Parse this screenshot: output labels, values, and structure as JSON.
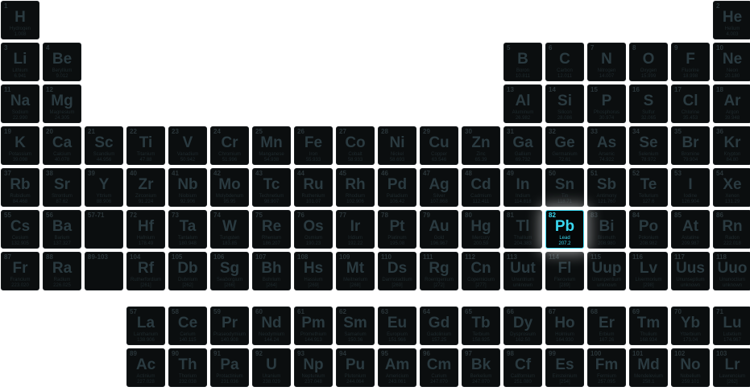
{
  "elements": [
    {
      "n": "1",
      "s": "H",
      "name": "Hydrogen",
      "m": "1.008",
      "row": 1,
      "col": 1
    },
    {
      "n": "2",
      "s": "He",
      "name": "Helium",
      "m": "4.003",
      "row": 1,
      "col": 18
    },
    {
      "n": "3",
      "s": "Li",
      "name": "Lithium",
      "m": "6.941",
      "row": 2,
      "col": 1
    },
    {
      "n": "4",
      "s": "Be",
      "name": "Beryllium",
      "m": "9.012",
      "row": 2,
      "col": 2
    },
    {
      "n": "5",
      "s": "B",
      "name": "Boron",
      "m": "10.811",
      "row": 2,
      "col": 13
    },
    {
      "n": "6",
      "s": "C",
      "name": "Carbon",
      "m": "12.011",
      "row": 2,
      "col": 14
    },
    {
      "n": "7",
      "s": "N",
      "name": "Nitrogen",
      "m": "14.007",
      "row": 2,
      "col": 15
    },
    {
      "n": "8",
      "s": "O",
      "name": "Oxygen",
      "m": "15.999",
      "row": 2,
      "col": 16
    },
    {
      "n": "9",
      "s": "F",
      "name": "Fluorine",
      "m": "18.998",
      "row": 2,
      "col": 17
    },
    {
      "n": "10",
      "s": "Ne",
      "name": "Neon",
      "m": "20.180",
      "row": 2,
      "col": 18
    },
    {
      "n": "11",
      "s": "Na",
      "name": "Sodium",
      "m": "22.990",
      "row": 3,
      "col": 1
    },
    {
      "n": "12",
      "s": "Mg",
      "name": "Magnesium",
      "m": "24.305",
      "row": 3,
      "col": 2
    },
    {
      "n": "13",
      "s": "Al",
      "name": "Aluminum",
      "m": "26.982",
      "row": 3,
      "col": 13
    },
    {
      "n": "14",
      "s": "Si",
      "name": "Silicon",
      "m": "28.086",
      "row": 3,
      "col": 14
    },
    {
      "n": "15",
      "s": "P",
      "name": "Phosphorus",
      "m": "30.974",
      "row": 3,
      "col": 15
    },
    {
      "n": "16",
      "s": "S",
      "name": "Sulfur",
      "m": "32.065",
      "row": 3,
      "col": 16
    },
    {
      "n": "17",
      "s": "Cl",
      "name": "Chlorine",
      "m": "35.453",
      "row": 3,
      "col": 17
    },
    {
      "n": "18",
      "s": "Ar",
      "name": "Argon",
      "m": "39.948",
      "row": 3,
      "col": 18
    },
    {
      "n": "19",
      "s": "K",
      "name": "Potassium",
      "m": "39.098",
      "row": 4,
      "col": 1
    },
    {
      "n": "20",
      "s": "Ca",
      "name": "Calcium",
      "m": "40.078",
      "row": 4,
      "col": 2
    },
    {
      "n": "21",
      "s": "Sc",
      "name": "Scandium",
      "m": "44.956",
      "row": 4,
      "col": 3
    },
    {
      "n": "22",
      "s": "Ti",
      "name": "Titanium",
      "m": "47.88",
      "row": 4,
      "col": 4
    },
    {
      "n": "23",
      "s": "V",
      "name": "Vanadium",
      "m": "50.942",
      "row": 4,
      "col": 5
    },
    {
      "n": "24",
      "s": "Cr",
      "name": "Chromium",
      "m": "51.996",
      "row": 4,
      "col": 6
    },
    {
      "n": "25",
      "s": "Mn",
      "name": "Manganese",
      "m": "54.938",
      "row": 4,
      "col": 7
    },
    {
      "n": "26",
      "s": "Fe",
      "name": "Iron",
      "m": "55.933",
      "row": 4,
      "col": 8
    },
    {
      "n": "27",
      "s": "Co",
      "name": "Cobalt",
      "m": "58.933",
      "row": 4,
      "col": 9
    },
    {
      "n": "28",
      "s": "Ni",
      "name": "Nickel",
      "m": "58.693",
      "row": 4,
      "col": 10
    },
    {
      "n": "29",
      "s": "Cu",
      "name": "Copper",
      "m": "63.546",
      "row": 4,
      "col": 11
    },
    {
      "n": "30",
      "s": "Zn",
      "name": "Zinc",
      "m": "65.39",
      "row": 4,
      "col": 12
    },
    {
      "n": "31",
      "s": "Ga",
      "name": "Gallium",
      "m": "69.732",
      "row": 4,
      "col": 13
    },
    {
      "n": "32",
      "s": "Ge",
      "name": "Germanium",
      "m": "72.61",
      "row": 4,
      "col": 14
    },
    {
      "n": "33",
      "s": "As",
      "name": "Arsenic",
      "m": "74.922",
      "row": 4,
      "col": 15
    },
    {
      "n": "34",
      "s": "Se",
      "name": "Selenium",
      "m": "78.972",
      "row": 4,
      "col": 16
    },
    {
      "n": "35",
      "s": "Br",
      "name": "Bromine",
      "m": "79.904",
      "row": 4,
      "col": 17
    },
    {
      "n": "36",
      "s": "Kr",
      "name": "Krypton",
      "m": "84.80",
      "row": 4,
      "col": 18
    },
    {
      "n": "37",
      "s": "Rb",
      "name": "Rubidium",
      "m": "84.468",
      "row": 5,
      "col": 1
    },
    {
      "n": "38",
      "s": "Sr",
      "name": "Strontium",
      "m": "87.62",
      "row": 5,
      "col": 2
    },
    {
      "n": "39",
      "s": "Y",
      "name": "Yttrium",
      "m": "88.906",
      "row": 5,
      "col": 3
    },
    {
      "n": "40",
      "s": "Zr",
      "name": "Zirconium",
      "m": "91.224",
      "row": 5,
      "col": 4
    },
    {
      "n": "41",
      "s": "Nb",
      "name": "Niobium",
      "m": "92.906",
      "row": 5,
      "col": 5
    },
    {
      "n": "42",
      "s": "Mo",
      "name": "Molybdenum",
      "m": "95.95",
      "row": 5,
      "col": 6
    },
    {
      "n": "43",
      "s": "Tc",
      "name": "Technetium",
      "m": "98.907",
      "row": 5,
      "col": 7
    },
    {
      "n": "44",
      "s": "Ru",
      "name": "Ruthenium",
      "m": "101.07",
      "row": 5,
      "col": 8
    },
    {
      "n": "45",
      "s": "Rh",
      "name": "Rhodium",
      "m": "102.906",
      "row": 5,
      "col": 9
    },
    {
      "n": "46",
      "s": "Pd",
      "name": "Palladium",
      "m": "106.42",
      "row": 5,
      "col": 10
    },
    {
      "n": "47",
      "s": "Ag",
      "name": "Silver",
      "m": "107.868",
      "row": 5,
      "col": 11
    },
    {
      "n": "48",
      "s": "Cd",
      "name": "Cadmium",
      "m": "112.411",
      "row": 5,
      "col": 12
    },
    {
      "n": "49",
      "s": "In",
      "name": "Indium",
      "m": "114.818",
      "row": 5,
      "col": 13
    },
    {
      "n": "50",
      "s": "Sn",
      "name": "Tin",
      "m": "118.71",
      "row": 5,
      "col": 14
    },
    {
      "n": "51",
      "s": "Sb",
      "name": "Antimony",
      "m": "121.760",
      "row": 5,
      "col": 15
    },
    {
      "n": "52",
      "s": "Te",
      "name": "Tellurium",
      "m": "127.6",
      "row": 5,
      "col": 16
    },
    {
      "n": "53",
      "s": "I",
      "name": "Iodine",
      "m": "126.904",
      "row": 5,
      "col": 17
    },
    {
      "n": "54",
      "s": "Xe",
      "name": "Xenon",
      "m": "131.29",
      "row": 5,
      "col": 18
    },
    {
      "n": "55",
      "s": "Cs",
      "name": "Cesium",
      "m": "132.905",
      "row": 6,
      "col": 1
    },
    {
      "n": "56",
      "s": "Ba",
      "name": "Barium",
      "m": "137.327",
      "row": 6,
      "col": 2
    },
    {
      "n": "57-71",
      "s": "",
      "name": "",
      "m": "",
      "row": 6,
      "col": 3,
      "range": true
    },
    {
      "n": "72",
      "s": "Hf",
      "name": "Hafnium",
      "m": "178.49",
      "row": 6,
      "col": 4
    },
    {
      "n": "73",
      "s": "Ta",
      "name": "Tantalum",
      "m": "180.948",
      "row": 6,
      "col": 5
    },
    {
      "n": "74",
      "s": "W",
      "name": "Tungsten",
      "m": "183.85",
      "row": 6,
      "col": 6
    },
    {
      "n": "75",
      "s": "Re",
      "name": "Rhenium",
      "m": "186.207",
      "row": 6,
      "col": 7
    },
    {
      "n": "76",
      "s": "Os",
      "name": "Osmium",
      "m": "190.23",
      "row": 6,
      "col": 8
    },
    {
      "n": "77",
      "s": "Ir",
      "name": "Iridium",
      "m": "192.22",
      "row": 6,
      "col": 9
    },
    {
      "n": "78",
      "s": "Pt",
      "name": "Platinum",
      "m": "195.08",
      "row": 6,
      "col": 10
    },
    {
      "n": "79",
      "s": "Au",
      "name": "Gold",
      "m": "196.967",
      "row": 6,
      "col": 11
    },
    {
      "n": "80",
      "s": "Hg",
      "name": "Mercury",
      "m": "200.59",
      "row": 6,
      "col": 12
    },
    {
      "n": "81",
      "s": "Tl",
      "name": "Thallium",
      "m": "204.383",
      "row": 6,
      "col": 13
    },
    {
      "n": "82",
      "s": "Pb",
      "name": "Lead",
      "m": "207.2",
      "row": 6,
      "col": 14,
      "active": true
    },
    {
      "n": "83",
      "s": "Bi",
      "name": "Bismuth",
      "m": "208.980",
      "row": 6,
      "col": 15
    },
    {
      "n": "84",
      "s": "Po",
      "name": "Polonium",
      "m": "208.982",
      "row": 6,
      "col": 16
    },
    {
      "n": "85",
      "s": "At",
      "name": "Astatine",
      "m": "209.987",
      "row": 6,
      "col": 17
    },
    {
      "n": "86",
      "s": "Rn",
      "name": "Radon",
      "m": "222.018",
      "row": 6,
      "col": 18
    },
    {
      "n": "87",
      "s": "Fr",
      "name": "Francium",
      "m": "223.020",
      "row": 7,
      "col": 1
    },
    {
      "n": "88",
      "s": "Ra",
      "name": "Radium",
      "m": "226.025",
      "row": 7,
      "col": 2
    },
    {
      "n": "89-103",
      "s": "",
      "name": "",
      "m": "",
      "row": 7,
      "col": 3,
      "range": true
    },
    {
      "n": "104",
      "s": "Rf",
      "name": "Rutherfordium",
      "m": "[261]",
      "row": 7,
      "col": 4
    },
    {
      "n": "105",
      "s": "Db",
      "name": "Dubnium",
      "m": "[262]",
      "row": 7,
      "col": 5
    },
    {
      "n": "106",
      "s": "Sg",
      "name": "Seaborgium",
      "m": "[266]",
      "row": 7,
      "col": 6
    },
    {
      "n": "107",
      "s": "Bh",
      "name": "Bohrium",
      "m": "[264]",
      "row": 7,
      "col": 7
    },
    {
      "n": "108",
      "s": "Hs",
      "name": "Hassium",
      "m": "[269]",
      "row": 7,
      "col": 8
    },
    {
      "n": "109",
      "s": "Mt",
      "name": "Meitnerium",
      "m": "[268]",
      "row": 7,
      "col": 9
    },
    {
      "n": "110",
      "s": "Ds",
      "name": "Darmstadtium",
      "m": "[269]",
      "row": 7,
      "col": 10
    },
    {
      "n": "111",
      "s": "Rg",
      "name": "Roentgenium",
      "m": "[272]",
      "row": 7,
      "col": 11
    },
    {
      "n": "112",
      "s": "Cn",
      "name": "Copernicium",
      "m": "[277]",
      "row": 7,
      "col": 12
    },
    {
      "n": "113",
      "s": "Uut",
      "name": "Ununtrium",
      "m": "unknown",
      "row": 7,
      "col": 13
    },
    {
      "n": "114",
      "s": "Fl",
      "name": "Flerovium",
      "m": "[289]",
      "row": 7,
      "col": 14
    },
    {
      "n": "115",
      "s": "Uup",
      "name": "Ununpentium",
      "m": "unknown",
      "row": 7,
      "col": 15
    },
    {
      "n": "116",
      "s": "Lv",
      "name": "Livermorium",
      "m": "[298]",
      "row": 7,
      "col": 16
    },
    {
      "n": "117",
      "s": "Uus",
      "name": "Ununseptium",
      "m": "unknown",
      "row": 7,
      "col": 17
    },
    {
      "n": "118",
      "s": "Uuo",
      "name": "Ununoctium",
      "m": "unknown",
      "row": 7,
      "col": 18
    },
    {
      "n": "57",
      "s": "La",
      "name": "Lanthanum",
      "m": "138.906",
      "row": 8,
      "col": 4
    },
    {
      "n": "58",
      "s": "Ce",
      "name": "Cerium",
      "m": "140.115",
      "row": 8,
      "col": 5
    },
    {
      "n": "59",
      "s": "Pr",
      "name": "Praseodymium",
      "m": "140.908",
      "row": 8,
      "col": 6
    },
    {
      "n": "60",
      "s": "Nd",
      "name": "Neodymium",
      "m": "144.24",
      "row": 8,
      "col": 7
    },
    {
      "n": "61",
      "s": "Pm",
      "name": "Promethium",
      "m": "144.913",
      "row": 8,
      "col": 8
    },
    {
      "n": "62",
      "s": "Sm",
      "name": "Samarium",
      "m": "150.36",
      "row": 8,
      "col": 9
    },
    {
      "n": "63",
      "s": "Eu",
      "name": "Europium",
      "m": "151.966",
      "row": 8,
      "col": 10
    },
    {
      "n": "64",
      "s": "Gd",
      "name": "Gadolinium",
      "m": "157.25",
      "row": 8,
      "col": 11
    },
    {
      "n": "65",
      "s": "Tb",
      "name": "Terbium",
      "m": "158.925",
      "row": 8,
      "col": 12
    },
    {
      "n": "66",
      "s": "Dy",
      "name": "Dysprosium",
      "m": "162.50",
      "row": 8,
      "col": 13
    },
    {
      "n": "67",
      "s": "Ho",
      "name": "Holmium",
      "m": "164.930",
      "row": 8,
      "col": 14
    },
    {
      "n": "68",
      "s": "Er",
      "name": "Erbium",
      "m": "167.26",
      "row": 8,
      "col": 15
    },
    {
      "n": "69",
      "s": "Tm",
      "name": "Thulium",
      "m": "168.934",
      "row": 8,
      "col": 16
    },
    {
      "n": "70",
      "s": "Yb",
      "name": "Ytterbium",
      "m": "173.04",
      "row": 8,
      "col": 17
    },
    {
      "n": "71",
      "s": "Lu",
      "name": "Lutetium",
      "m": "174.967",
      "row": 8,
      "col": 18
    },
    {
      "n": "89",
      "s": "Ac",
      "name": "Actinium",
      "m": "227.028",
      "row": 9,
      "col": 4
    },
    {
      "n": "90",
      "s": "Th",
      "name": "Thorium",
      "m": "232.038",
      "row": 9,
      "col": 5
    },
    {
      "n": "91",
      "s": "Pa",
      "name": "Protactinium",
      "m": "231.036",
      "row": 9,
      "col": 6
    },
    {
      "n": "92",
      "s": "U",
      "name": "Uranium",
      "m": "238.029",
      "row": 9,
      "col": 7
    },
    {
      "n": "93",
      "s": "Np",
      "name": "Neptunium",
      "m": "237.048",
      "row": 9,
      "col": 8
    },
    {
      "n": "94",
      "s": "Pu",
      "name": "Plutonium",
      "m": "244.064",
      "row": 9,
      "col": 9
    },
    {
      "n": "95",
      "s": "Am",
      "name": "Americium",
      "m": "243.061",
      "row": 9,
      "col": 10
    },
    {
      "n": "96",
      "s": "Cm",
      "name": "Curium",
      "m": "247.070",
      "row": 9,
      "col": 11
    },
    {
      "n": "97",
      "s": "Bk",
      "name": "Berkelium",
      "m": "247.070",
      "row": 9,
      "col": 12
    },
    {
      "n": "98",
      "s": "Cf",
      "name": "Californium",
      "m": "251.080",
      "row": 9,
      "col": 13
    },
    {
      "n": "99",
      "s": "Es",
      "name": "Einsteinium",
      "m": "[254]",
      "row": 9,
      "col": 14
    },
    {
      "n": "100",
      "s": "Fm",
      "name": "Fermium",
      "m": "257.095",
      "row": 9,
      "col": 15
    },
    {
      "n": "101",
      "s": "Md",
      "name": "Mendelevium",
      "m": "258.1",
      "row": 9,
      "col": 16
    },
    {
      "n": "102",
      "s": "No",
      "name": "Nobelium",
      "m": "259.101",
      "row": 9,
      "col": 17
    },
    {
      "n": "103",
      "s": "Lr",
      "name": "Lawrencium",
      "m": "[262]",
      "row": 9,
      "col": 18
    }
  ],
  "colors": {
    "cell_background": "#0b0e0f",
    "active_accent": "#3ad7f0",
    "page_background": "#ffffff"
  }
}
